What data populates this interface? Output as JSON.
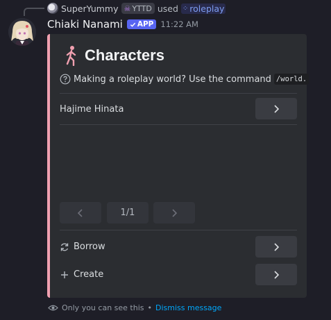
{
  "reply": {
    "username": "SuperYummy",
    "tag_label": "YTTD",
    "used_label": "used",
    "command": "roleplay"
  },
  "message": {
    "author": "Chiaki Nanami",
    "app_badge": "APP",
    "timestamp": "11:22 AM"
  },
  "embed": {
    "accent_color": "#f0a0b0",
    "title": "Characters",
    "description": "Making a roleplay world? Use the command",
    "command_code": "/world.",
    "items": [
      {
        "label": "Hajime Hinata"
      }
    ],
    "pagination": {
      "page_label": "1/1"
    },
    "actions": [
      {
        "label": "Borrow",
        "icon": "refresh-icon"
      },
      {
        "label": "Create",
        "icon": "plus-icon"
      }
    ]
  },
  "footer": {
    "notice": "Only you can see this",
    "separator": "•",
    "dismiss": "Dismiss message"
  }
}
